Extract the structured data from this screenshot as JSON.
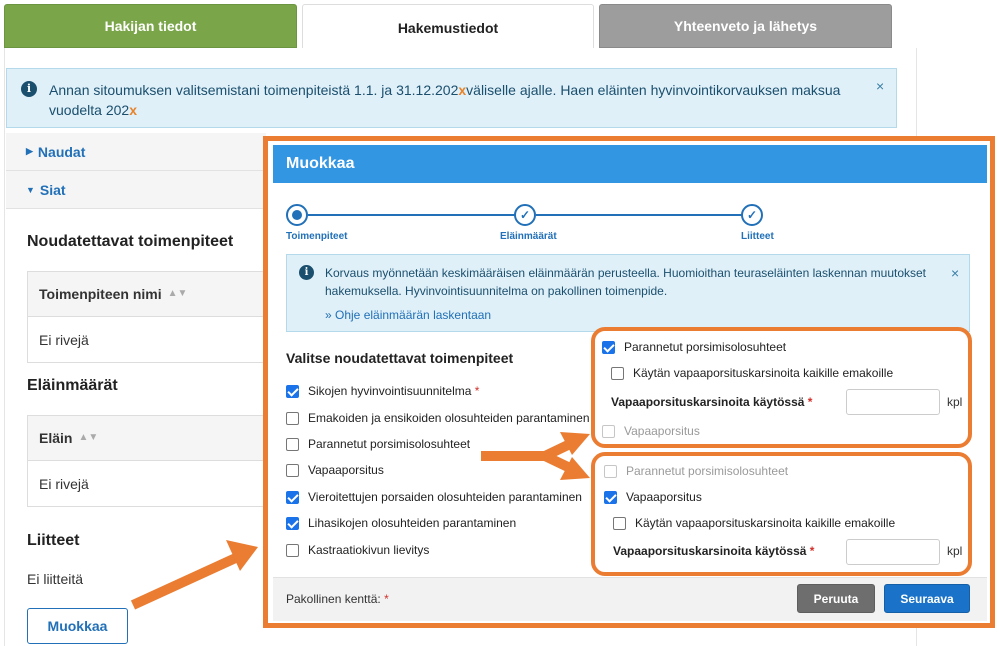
{
  "tabs": [
    "Hakijan tiedot",
    "Hakemustiedot",
    "Yhteenveto ja lähetys"
  ],
  "main_alert": {
    "text_part1": "Annan sitoumuksen valitsemistani toimenpiteistä 1.1. ja 31.12.202",
    "x1": "x",
    "text_part2": "väliselle ajalle. Haen eläinten hyvinvointikorvauksen maksua vuodelta 202",
    "x2": "x",
    "close": "×"
  },
  "accordion": [
    {
      "label": "Naudat",
      "caret": "▶"
    },
    {
      "label": "Siat",
      "caret": "▼"
    }
  ],
  "left": {
    "measures_title": "Noudatettavat toimenpiteet",
    "measures_col": "Toimenpiteen nimi",
    "measures_empty": "Ei rivejä",
    "animals_title": "Eläinmäärät",
    "animals_col": "Eläin",
    "animals_empty": "Ei rivejä",
    "attachments_title": "Liitteet",
    "attachments_empty": "Ei liitteitä",
    "edit_button": "Muokkaa",
    "sort_icon": "▲▼"
  },
  "modal": {
    "title": "Muokkaa",
    "steps": [
      "Toimenpiteet",
      "Eläinmäärät",
      "Liitteet"
    ],
    "alert_text": "Korvaus myönnetään keskimääräisen eläinmäärän perusteella. Huomioithan teuraseläinten laskennan muutokset hakemuksella. Hyvinvointisuunnitelma on pakollinen toimenpide.",
    "alert_link": "» Ohje eläinmäärän laskentaan",
    "alert_close": "×",
    "form_title": "Valitse noudatettavat toimenpiteet",
    "options": [
      {
        "label": "Sikojen hyvinvointisuunnitelma",
        "checked": true,
        "required": true
      },
      {
        "label": "Emakoiden ja ensikoiden olosuhteiden parantaminen",
        "checked": false,
        "required": false
      },
      {
        "label": "Parannetut porsimisolosuhteet",
        "checked": false,
        "required": false
      },
      {
        "label": "Vapaaporsitus",
        "checked": false,
        "required": false
      },
      {
        "label": "Vieroitettujen porsaiden olosuhteiden parantaminen",
        "checked": true,
        "required": false
      },
      {
        "label": "Lihasikojen olosuhteiden parantaminen",
        "checked": true,
        "required": false
      },
      {
        "label": "Kastraatiokivun lievitys",
        "checked": false,
        "required": false
      }
    ],
    "required_mark": "*",
    "footer_text": "Pakollinen kenttä:",
    "cancel": "Peruuta",
    "next": "Seuraava"
  },
  "callout1": {
    "option_main": "Parannetut porsimisolosuhteet",
    "option_sub": "Käytän vapaaporsituskarsinoita kaikille emakoille",
    "field_label": "Vapaaporsituskarsinoita käytössä",
    "unit": "kpl",
    "option_disabled": "Vapaaporsitus",
    "input_value": ""
  },
  "callout2": {
    "option_disabled": "Parannetut porsimisolosuhteet",
    "option_main": "Vapaaporsitus",
    "option_sub": "Käytän vapaaporsituskarsinoita kaikille emakoille",
    "field_label": "Vapaaporsituskarsinoita käytössä",
    "unit": "kpl",
    "input_value": ""
  },
  "colors": {
    "accent_orange": "#ea7d32",
    "modal_header": "#3396e3",
    "tab_active_green": "#7aa548"
  }
}
